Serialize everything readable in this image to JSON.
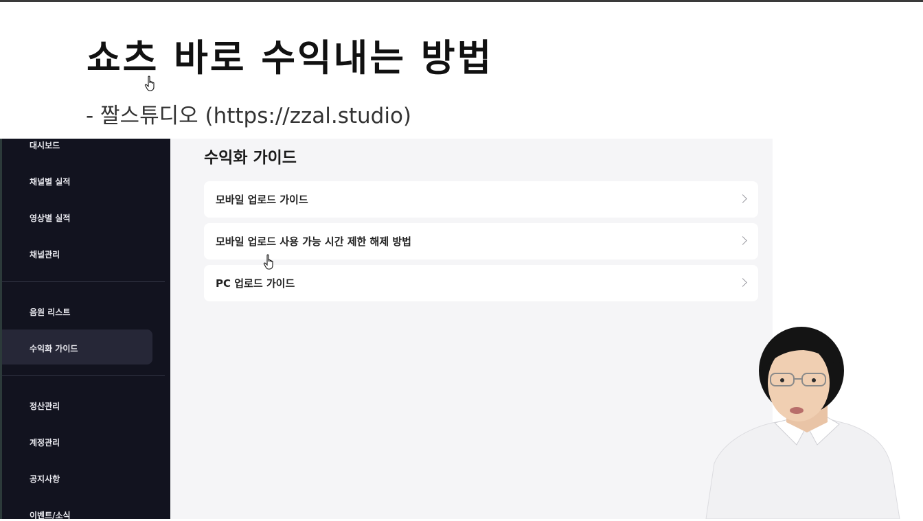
{
  "slide": {
    "title": "쇼츠 바로 수익내는 방법",
    "subtitle": "- 짤스튜디오 (https://zzal.studio)"
  },
  "sidebar": {
    "items": [
      {
        "label": "대시보드"
      },
      {
        "label": "채널별 실적"
      },
      {
        "label": "영상별 실적"
      },
      {
        "label": "채널관리"
      },
      {
        "label": "음원 리스트"
      },
      {
        "label": "수익화 가이드",
        "active": true
      },
      {
        "label": "정산관리"
      },
      {
        "label": "계정관리"
      },
      {
        "label": "공지사항"
      },
      {
        "label": "이벤트/소식"
      }
    ]
  },
  "main": {
    "title": "수익화 가이드",
    "guides": [
      {
        "label": "모바일 업로드 가이드"
      },
      {
        "label": "모바일 업로드 사용 가능 시간 제한 해제 방법"
      },
      {
        "label": "PC 업로드 가이드"
      }
    ]
  },
  "icons": {
    "chevron": "chevron-right-icon",
    "cursor": "hand-pointer-icon"
  },
  "colors": {
    "sidebar_bg": "#12131f",
    "sidebar_active": "#262737",
    "main_bg": "#f5f5f7"
  }
}
